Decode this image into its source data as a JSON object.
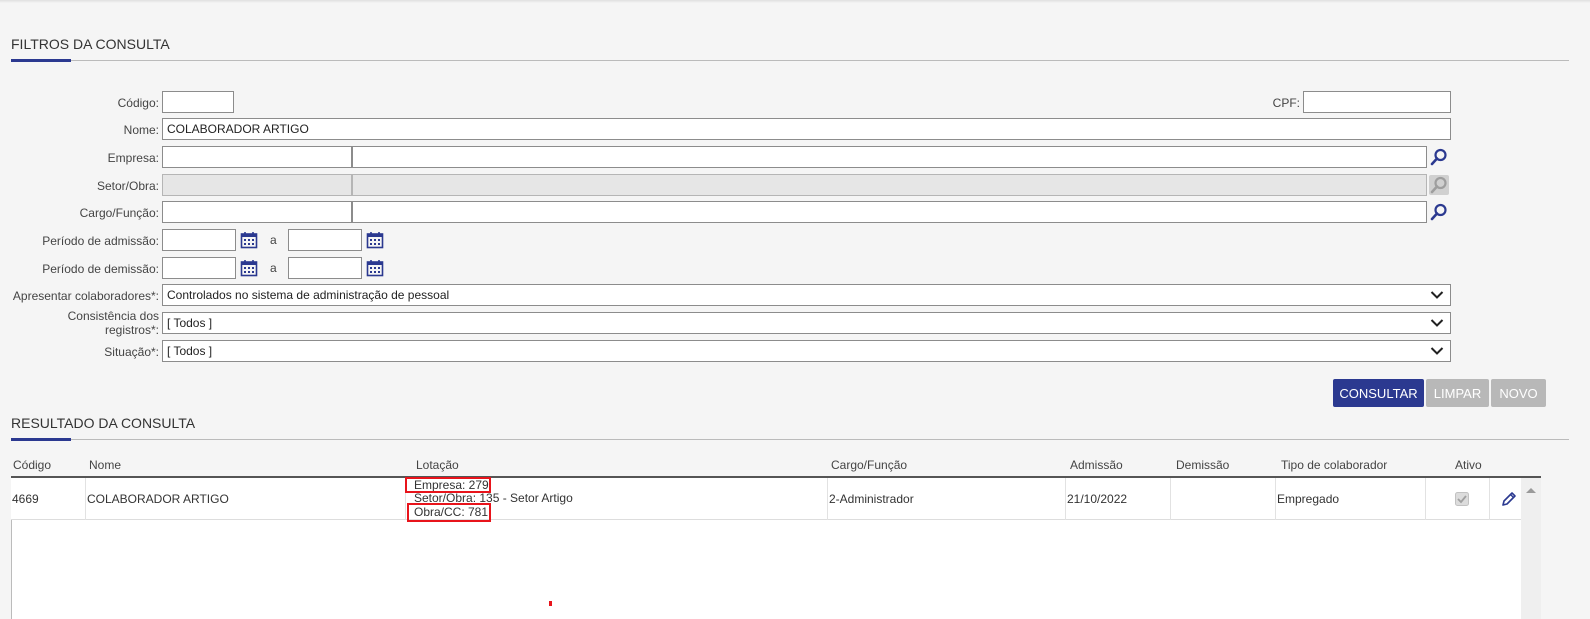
{
  "filters": {
    "title": "FILTROS DA CONSULTA",
    "codigo_label": "Código:",
    "codigo_value": "",
    "cpf_label": "CPF:",
    "cpf_value": "",
    "nome_label": "Nome:",
    "nome_value": "COLABORADOR ARTIGO",
    "empresa_label": "Empresa:",
    "setor_label": "Setor/Obra:",
    "cargo_label": "Cargo/Função:",
    "admissao_label": "Período de admissão:",
    "demissao_label": "Período de demissão:",
    "range_sep": "a",
    "apresentar_label": "Apresentar colaboradores*:",
    "apresentar_value": "Controlados no sistema de administração de pessoal",
    "consistencia_label_1": "Consistência dos",
    "consistencia_label_2": "registros*:",
    "consistencia_value": "[ Todos ]",
    "situacao_label": "Situação*:",
    "situacao_value": "[ Todos ]"
  },
  "actions": {
    "consultar": "CONSULTAR",
    "limpar": "LIMPAR",
    "novo": "NOVO"
  },
  "results": {
    "title": "RESULTADO DA CONSULTA",
    "columns": [
      "Código",
      "Nome",
      "Lotação",
      "Cargo/Função",
      "Admissão",
      "Demissão",
      "Tipo de colaborador",
      "Ativo"
    ],
    "rows": [
      {
        "codigo": "4669",
        "nome": "COLABORADOR ARTIGO",
        "lotacao_empresa": "Empresa: 279",
        "lotacao_setor": "Setor/Obra: 135 - Setor Artigo",
        "lotacao_obra": "Obra/CC: 781",
        "cargo": "2-Administrador",
        "admissao": "21/10/2022",
        "demissao": "",
        "tipo": "Empregado",
        "ativo": true
      }
    ]
  },
  "colors": {
    "primary": "#2b3990",
    "highlight_box": "#e8141b",
    "disabled_button": "#b8b8b8"
  },
  "icons": [
    "search-icon",
    "calendar-icon",
    "chevron-down-icon",
    "pencil-icon",
    "scroll-up-icon"
  ]
}
